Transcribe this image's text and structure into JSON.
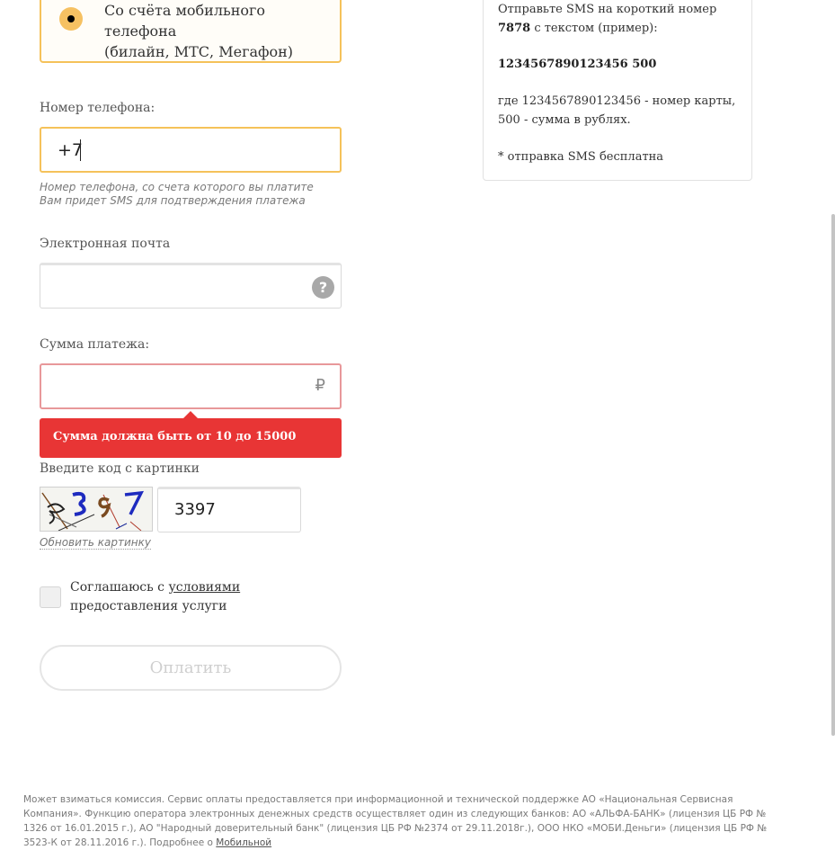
{
  "payment_option": {
    "line1": "Со счёта мобильного телефона",
    "line2": "(билайн, МТС, Мегафон)",
    "accent_color": "#f5c25a"
  },
  "phone": {
    "label": "Номер телефона:",
    "value": "+7",
    "hint_line1": "Номер телефона, со счета которого вы платите",
    "hint_line2": "Вам придет SMS для подтверждения платежа"
  },
  "email": {
    "label": "Электронная почта",
    "value": "",
    "help_icon": "question-circle-icon",
    "help_glyph": "?"
  },
  "amount": {
    "label": "Сумма платежа:",
    "value": "",
    "currency_symbol": "₽",
    "error": "Сумма должна быть от 10 до 15000",
    "error_color": "#e83535"
  },
  "captcha": {
    "label": "Введите код с картинки",
    "value": "3397",
    "refresh_label": "Обновить картинку"
  },
  "agreement": {
    "text_before": "Соглашаюсь с ",
    "link": "условиями",
    "text_after": " предоставления услуги",
    "checked": false
  },
  "pay_button": {
    "label": "Оплатить"
  },
  "sms_info": {
    "line1_prefix": "Отправьте SMS на короткий номер ",
    "short_number": "7878",
    "line1_suffix": " с текстом (пример):",
    "example": "1234567890123456 500",
    "explanation": "где 1234567890123456 - номер карты, 500 - сумма в рублях.",
    "note": "* отправка SMS бесплатна"
  },
  "footer": {
    "text": "Может взиматься комиссия. Сервис оплаты предоставляется при информационной и технической поддержке АО «Национальная Сервисная Компания». Функцию оператора электронных денежных средств осуществляет один из следующих банков: АО «АЛЬФА-БАНК» (лицензия ЦБ РФ № 1326 от 16.01.2015 г.), АО \"Народный доверительный банк\" (лицензия ЦБ РФ №2374 от 29.11.2018г.), ООО НКО «МОБИ.Деньги» (лицензия ЦБ РФ № 3523-К от 28.11.2016 г.). Подробнее о ",
    "link": "Мобильной"
  }
}
